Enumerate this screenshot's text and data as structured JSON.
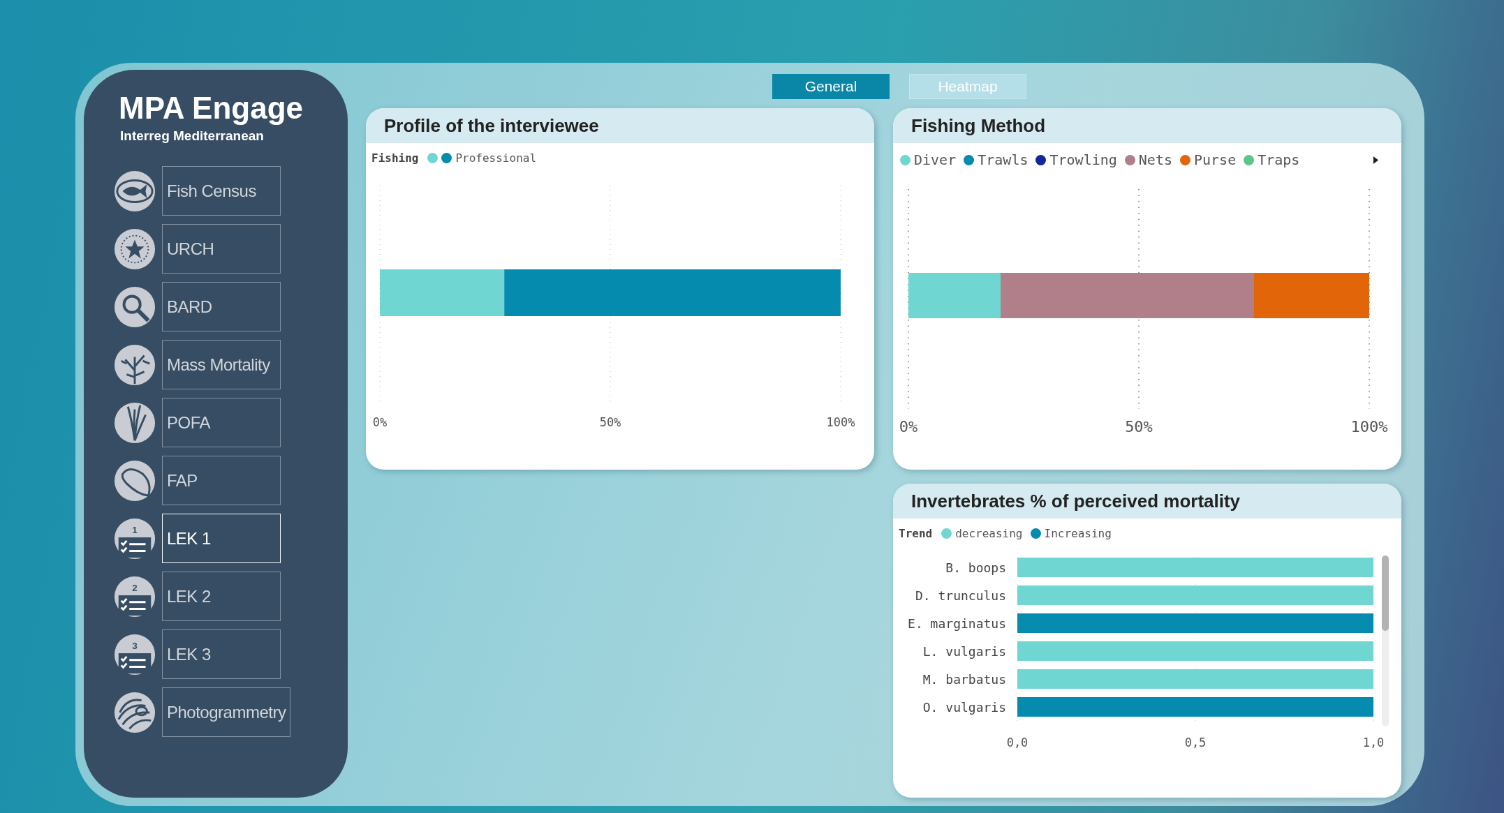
{
  "sidebar": {
    "title": "MPA Engage",
    "subtitle": "Interreg Mediterranean",
    "items": [
      {
        "label": "Fish Census",
        "selected": false
      },
      {
        "label": "URCH",
        "selected": false
      },
      {
        "label": "BARD",
        "selected": false
      },
      {
        "label": "Mass Mortality",
        "selected": false
      },
      {
        "label": "POFA",
        "selected": false
      },
      {
        "label": "FAP",
        "selected": false
      },
      {
        "label": "LEK 1",
        "selected": true,
        "icon_number": "1"
      },
      {
        "label": "LEK 2",
        "selected": false,
        "icon_number": "2"
      },
      {
        "label": "LEK 3",
        "selected": false,
        "icon_number": "3"
      },
      {
        "label": "Photogrammetry",
        "selected": false
      }
    ]
  },
  "tabs": [
    {
      "label": "General",
      "selected": true
    },
    {
      "label": "Heatmap",
      "selected": false
    }
  ],
  "profile": {
    "title": "Profile of the interviewee",
    "legend_title": "Fishing",
    "chart_data": {
      "type": "bar",
      "orientation": "horizontal",
      "stacked": true,
      "xlim": [
        0,
        100
      ],
      "xticks": [
        {
          "value": 0,
          "label": "0%"
        },
        {
          "value": 50,
          "label": "50%"
        },
        {
          "value": 100,
          "label": "100%"
        }
      ],
      "series": [
        {
          "color": "#6fd6d2",
          "values": [
            27
          ]
        },
        {
          "name": "Professional",
          "color": "#058bae",
          "values": [
            73
          ]
        }
      ]
    }
  },
  "fishing_method": {
    "title": "Fishing Method",
    "chart_data": {
      "type": "bar",
      "orientation": "horizontal",
      "stacked": true,
      "xlim": [
        0,
        100
      ],
      "xticks": [
        {
          "value": 0,
          "label": "0%"
        },
        {
          "value": 50,
          "label": "50%"
        },
        {
          "value": 100,
          "label": "100%"
        }
      ],
      "series": [
        {
          "name": "Diver",
          "color": "#6fd6d2",
          "values": [
            20
          ]
        },
        {
          "name": "Trawls",
          "color": "#058bae",
          "values": [
            0
          ]
        },
        {
          "name": "Trowling",
          "color": "#14279a",
          "values": [
            0
          ]
        },
        {
          "name": "Nets",
          "color": "#b07f89",
          "values": [
            55
          ]
        },
        {
          "name": "Purse",
          "color": "#e2650a",
          "values": [
            25
          ]
        },
        {
          "name": "Traps",
          "color": "#5cc58a",
          "values": [
            0
          ]
        }
      ]
    }
  },
  "invertebrates": {
    "title": "Invertebrates % of perceived mortality",
    "legend_title": "Trend",
    "chart_data": {
      "type": "bar",
      "orientation": "horizontal",
      "categories": [
        "B. boops",
        "D. trunculus",
        "E. marginatus",
        "L. vulgaris",
        "M. barbatus",
        "O. vulgaris"
      ],
      "xlim": [
        0,
        1
      ],
      "xticks": [
        {
          "value": 0,
          "label": "0,0"
        },
        {
          "value": 0.5,
          "label": "0,5"
        },
        {
          "value": 1,
          "label": "1,0"
        }
      ],
      "series": [
        {
          "name": "decreasing",
          "color": "#6fd6d2",
          "values": [
            1,
            1,
            null,
            1,
            1,
            null
          ]
        },
        {
          "name": "Increasing",
          "color": "#058bae",
          "values": [
            null,
            null,
            1,
            null,
            null,
            1
          ]
        }
      ]
    }
  }
}
